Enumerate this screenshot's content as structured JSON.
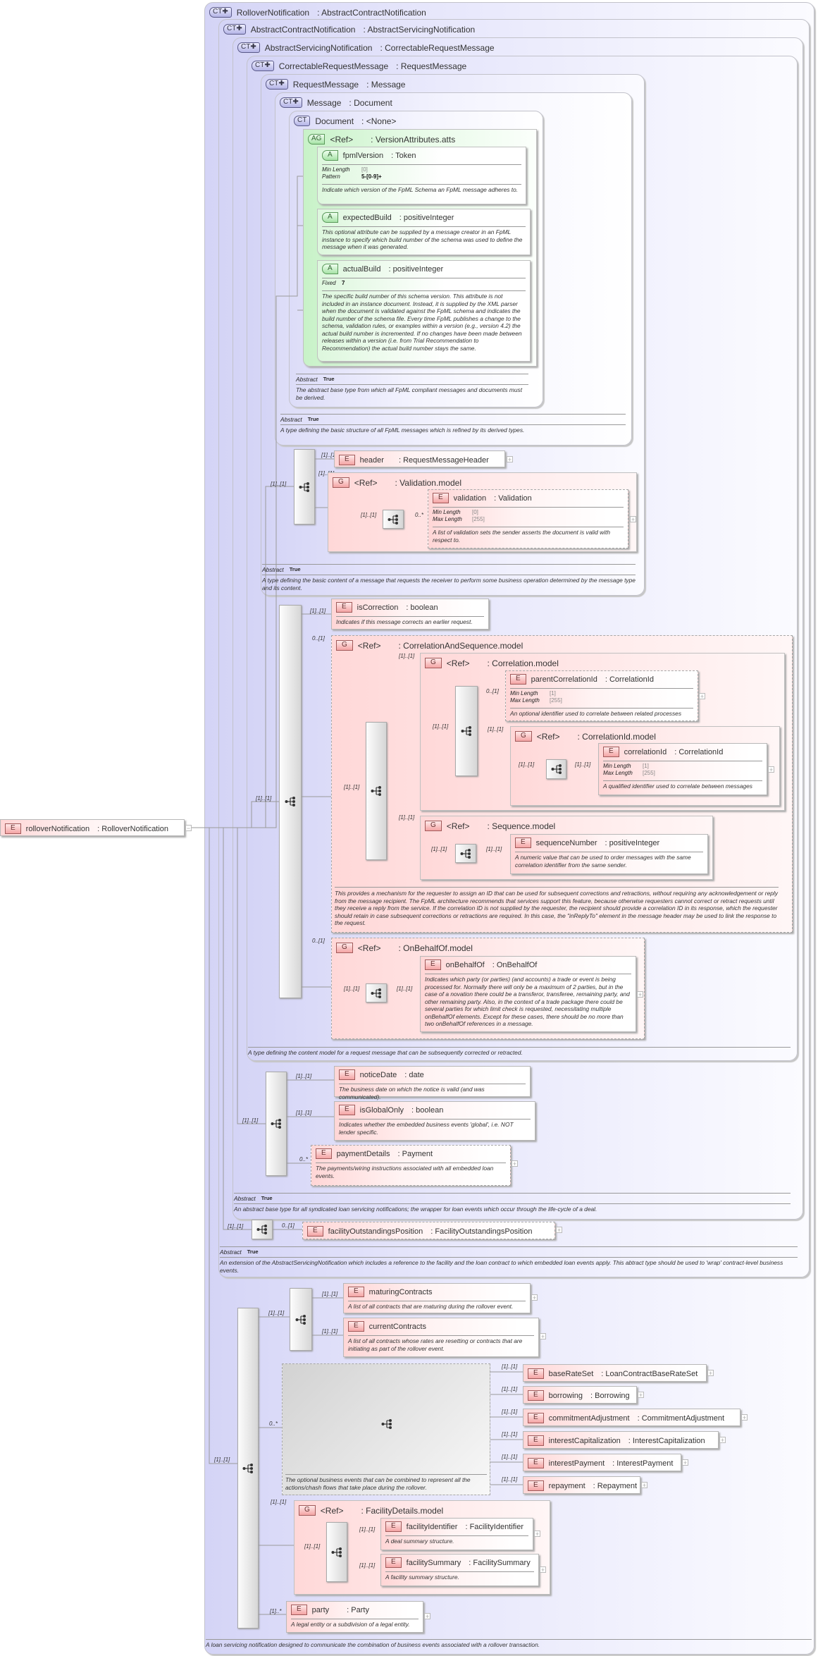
{
  "badges": {
    "ct": "CT✚",
    "ct_plain": "CT",
    "element": "E",
    "group": "G",
    "attr": "A",
    "attr_group": "AG"
  },
  "ref": "<Ref>",
  "card": {
    "one": "[1]..[1]",
    "opt": "0..[1]",
    "many": "0..*",
    "one_many": "[1]..*"
  },
  "abstract": {
    "label": "Abstract",
    "value": "True"
  },
  "root": {
    "name": "rolloverNotification",
    "type": "RolloverNotification",
    "collapse": "−"
  },
  "types": {
    "rollover": {
      "name": "RolloverNotification",
      "base": "AbstractContractNotification",
      "description": "A loan servicing notification designed to communicate the combination of business events associated with a rollover transaction."
    },
    "abscontract": {
      "name": "AbstractContractNotification",
      "base": "AbstractServicingNotification",
      "description": "An extension of the AbstractServicingNotification which includes a reference to the facility and the loan contract to which embedded loan events apply. This abtract type should be used to 'wrap' contract-level business events."
    },
    "absserv": {
      "name": "AbstractServicingNotification",
      "base": "CorrectableRequestMessage",
      "description": "An abstract base type for all syndicated loan servicing notifications; the wrapper for loan events which occur through the life-cycle of a deal."
    },
    "correctable": {
      "name": "CorrectableRequestMessage",
      "base": "RequestMessage",
      "description": "A type defining the content model for a request message that can be subsequently corrected or retracted."
    },
    "reqmsg": {
      "name": "RequestMessage",
      "base": "Message",
      "description": "A type defining the basic content of a message that requests the receiver to perform some business operation determined by the message type and its content."
    },
    "message": {
      "name": "Message",
      "base": "Document",
      "description": "A type defining the basic structure of all FpML messages which is refined by its derived types."
    },
    "document": {
      "name": "Document",
      "base": "<None>",
      "description": "The abstract base type from which all FpML compliant messages and documents must be derived."
    }
  },
  "attr_group": {
    "name": "VersionAttributes.atts"
  },
  "attributes": {
    "fpmlVersion": {
      "name": "fpmlVersion",
      "type": "Token",
      "facets": [
        {
          "label": "Min Length",
          "value": "[0]"
        },
        {
          "label": "Pattern",
          "value": "5-[0-9]+"
        }
      ],
      "description": "Indicate which version of the FpML Schema an FpML message adheres to."
    },
    "expectedBuild": {
      "name": "expectedBuild",
      "type": "positiveInteger",
      "description": "This optional attribute can be supplied by a message creator in an FpML instance to specify which build number of the schema was used to define the message when it was generated."
    },
    "actualBuild": {
      "name": "actualBuild",
      "type": "positiveInteger",
      "facets": [
        {
          "label": "Fixed",
          "value": "7"
        }
      ],
      "description": "The specific build number of this schema version. This attribute is not included in an instance document. Instead, it is supplied by the XML parser when the document is validated against the FpML schema and indicates the build number of the schema file. Every time FpML publishes a change to the schema, validation rules, or examples within a version (e.g., version 4.2) the actual build number is incremented. If no changes have been made between releases within a version (i.e. from Trial Recommendation to Recommendation) the actual build number stays the same."
    }
  },
  "groups": {
    "validation_model": "Validation.model",
    "corr_seq_model": "CorrelationAndSequence.model",
    "corr_seq_description": "This provides a mechanism for the requester to assign an ID that can be used for subsequent corrections and retractions, without requiring any acknowledgement or reply from the message recipient. The FpML architecture recommends that services support this feature, because otherwise requesters cannot correct or retract requests until they receive a reply from the service. If the correlation ID is not supplied by the requester, the recipient should provide a correlation ID in its response, which the requester should retain in case subsequent corrections or retractions are required. In this case, the \"inReplyTo\" element in the message header may be used to link the response to the request.",
    "correlation_model": "Correlation.model",
    "correlationid_model": "CorrelationId.model",
    "sequence_model": "Sequence.model",
    "onbehalfof_model": "OnBehalfOf.model",
    "facility_details_model": "FacilityDetails.model"
  },
  "choice_description": "The optional business events that can be combined to represent all the actions/chash flows that take place during the rollover.",
  "expand": "+",
  "elements": {
    "header": {
      "name": "header",
      "type": "RequestMessageHeader"
    },
    "validation": {
      "name": "validation",
      "type": "Validation",
      "facets": [
        {
          "label": "Min Length",
          "value": "[0]"
        },
        {
          "label": "Max Length",
          "value": "[255]"
        }
      ],
      "description": "A list of validation sets the sender asserts the document is valid with respect to."
    },
    "isCorrection": {
      "name": "isCorrection",
      "type": "boolean",
      "description": "Indicates if this message corrects an earlier request."
    },
    "parentCorrelationId": {
      "name": "parentCorrelationId",
      "type": "CorrelationId",
      "facets": [
        {
          "label": "Min Length",
          "value": "[1]"
        },
        {
          "label": "Max Length",
          "value": "[255]"
        }
      ],
      "description": "An optional identifier used to correlate between related processes"
    },
    "correlationId": {
      "name": "correlationId",
      "type": "CorrelationId",
      "facets": [
        {
          "label": "Min Length",
          "value": "[1]"
        },
        {
          "label": "Max Length",
          "value": "[255]"
        }
      ],
      "description": "A qualified identifier used to correlate between messages"
    },
    "sequenceNumber": {
      "name": "sequenceNumber",
      "type": "positiveInteger",
      "description": "A numeric value that can be used to order messages with the same correlation identifier from the same sender."
    },
    "onBehalfOf": {
      "name": "onBehalfOf",
      "type": "OnBehalfOf",
      "description": "Indicates which party (or parties) (and accounts) a trade or event is being processed for. Normally there will only be a maximum of 2 parties, but in the case of a novation there could be a transferor, transferee, remaining party, and other remaining party. Also, in the context of a trade package there could be several parties for which limit check is requested, necessitating multiple onBehalfOf elements. Except for these cases, there should be no more than two onBehalfOf references in a message."
    },
    "noticeDate": {
      "name": "noticeDate",
      "type": "date",
      "description": "The business date on which the notice is valid (and was communicated)."
    },
    "isGlobalOnly": {
      "name": "isGlobalOnly",
      "type": "boolean",
      "description": "Indicates whether the embedded business events 'global', i.e. NOT lender specific."
    },
    "paymentDetails": {
      "name": "paymentDetails",
      "type": "Payment",
      "description": "The payments/wiring instructions associated with all embedded loan events."
    },
    "facilityOutstandingsPosition": {
      "name": "facilityOutstandingsPosition",
      "type": "FacilityOutstandingsPosition"
    },
    "maturingContracts": {
      "name": "maturingContracts",
      "description": "A list of all contracts that are maturing during the rollover event."
    },
    "currentContracts": {
      "name": "currentContracts",
      "description": "A list of all contracts whose rates are resetting or contracts that are initiating as part of the rollover event."
    },
    "baseRateSet": {
      "name": "baseRateSet",
      "type": "LoanContractBaseRateSet"
    },
    "borrowing": {
      "name": "borrowing",
      "type": "Borrowing"
    },
    "commitmentAdjustment": {
      "name": "commitmentAdjustment",
      "type": "CommitmentAdjustment"
    },
    "interestCapitalization": {
      "name": "interestCapitalization",
      "type": "InterestCapitalization"
    },
    "interestPayment": {
      "name": "interestPayment",
      "type": "InterestPayment"
    },
    "repayment": {
      "name": "repayment",
      "type": "Repayment"
    },
    "facilityIdentifier": {
      "name": "facilityIdentifier",
      "type": "FacilityIdentifier",
      "description": "A deal summary structure."
    },
    "facilitySummary": {
      "name": "facilitySummary",
      "type": "FacilitySummary",
      "description": "A facility summary structure."
    },
    "party": {
      "name": "party",
      "type": "Party",
      "description": "A legal entity or a subdivision of a legal entity."
    }
  }
}
